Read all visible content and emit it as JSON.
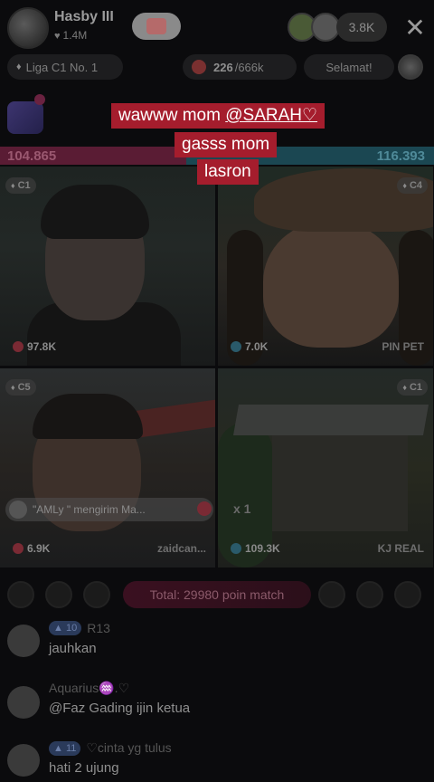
{
  "header": {
    "host_name": "Hasby III",
    "host_likes": "1.4M",
    "viewer_count": "3.8K",
    "close_icon": "close-icon"
  },
  "stats_row": {
    "league_label": "Liga C1 No. 1",
    "score_label": "226",
    "score_suffix": "/666k",
    "congrats_label": "Selamat!"
  },
  "battle": {
    "left_score": "104.865",
    "right_score": "116.393",
    "colors": {
      "left": "#5a1c34",
      "right": "#1b4752"
    },
    "cells": [
      {
        "badge": "C1",
        "score": "97.8K",
        "name": ""
      },
      {
        "badge": "C4",
        "score": "7.0K",
        "name": "PIN PET"
      },
      {
        "badge": "C5",
        "score": "6.9K",
        "name": "zaidcan..."
      },
      {
        "badge": "C1",
        "score": "109.3K",
        "name": "KJ REAL"
      }
    ],
    "gift_banner": "\"AMLy \" mengirim Ma...",
    "gift_count": "x 1"
  },
  "total_label": "Total: 29980 poin match",
  "chat": [
    {
      "level": "10",
      "name": "R13",
      "text": "jauhkan"
    },
    {
      "level": "",
      "name": "Aquarius♒.♡",
      "text": "@Faz Gading ijin ketua"
    },
    {
      "level": "11",
      "name": "♡cinta yg tulus",
      "text": "hati 2 ujung"
    }
  ],
  "overlay": {
    "line1_prefix": "wawww mom ",
    "line1_mention": "@SARAH♡",
    "line2": "gasss mom",
    "line3": "lasron",
    "color": "#a51d2d"
  }
}
